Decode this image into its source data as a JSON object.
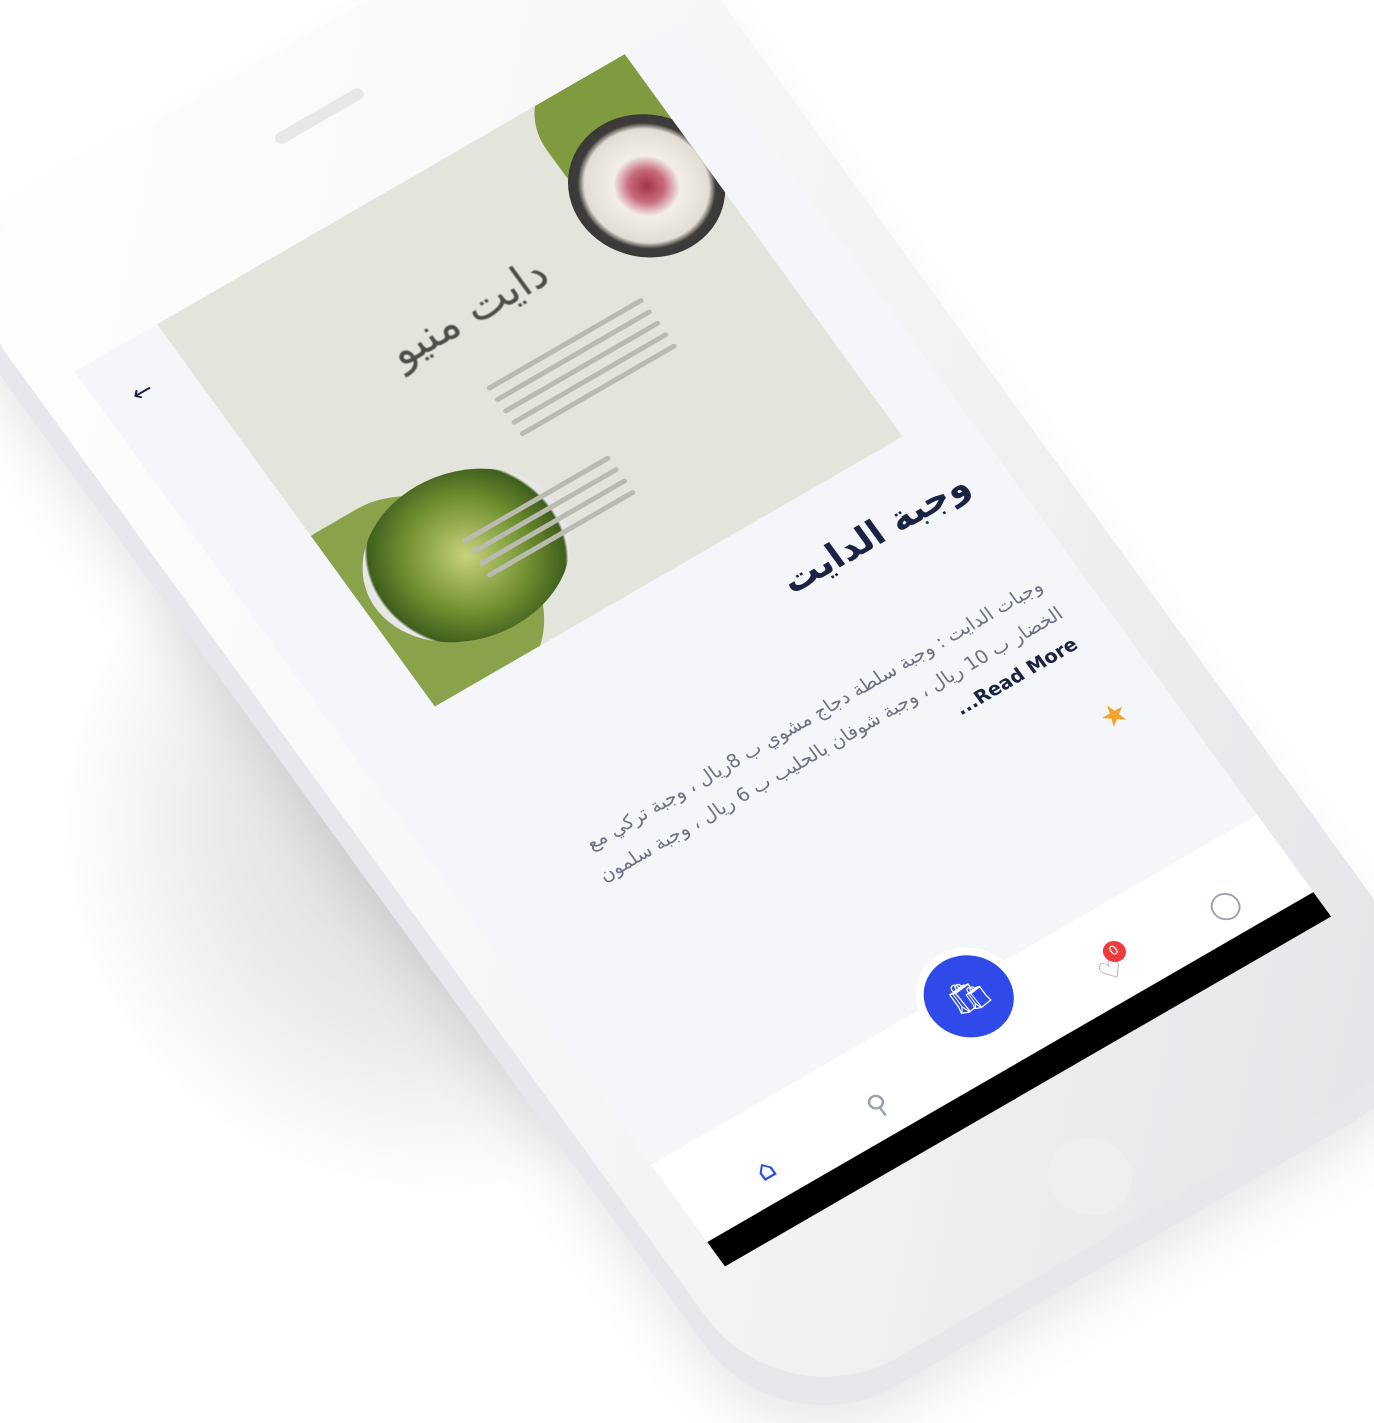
{
  "screen": {
    "back_icon": "arrow-back-icon",
    "hero_image": {
      "title": "دايت منيو"
    },
    "meal": {
      "title": "وجبة الدايت",
      "description": "وجبات الدايت : وجبة سلطة دجاج مشوي ب 8ريال ، وجبة تركي مع الخضار ب 10 ريال ، وجبة شوفان بالحليب ب 6 ريال ، وجبة سلمون",
      "read_more": "Read More..."
    },
    "rating_icon": "star-icon",
    "tabbar": {
      "home_icon": "home-icon",
      "search_icon": "search-icon",
      "cart_icon": "shopping-bag-icon",
      "favorites_icon": "heart-icon",
      "favorites_count": "0",
      "profile_icon": "user-icon"
    },
    "colors": {
      "primary": "#2f4ae8",
      "title": "#1b2343",
      "star": "#f3a52b",
      "badge": "#ee3b3b"
    }
  }
}
